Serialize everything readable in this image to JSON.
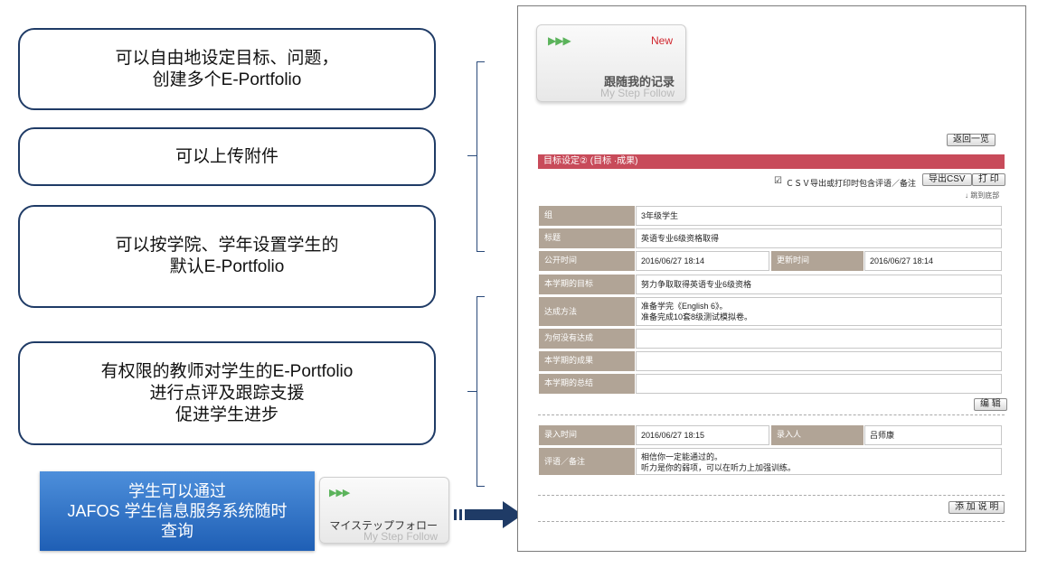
{
  "features": [
    {
      "lines": [
        "可以自由地设定目标、问题，",
        "创建多个E-Portfolio"
      ]
    },
    {
      "lines": [
        "可以上传附件"
      ]
    },
    {
      "lines": [
        "可以按学院、学年设置学生的",
        "默认E-Portfolio"
      ]
    },
    {
      "lines": [
        "有权限的教师对学生的E-Portfolio",
        "进行点评及跟踪支援",
        "促进学生进步"
      ]
    }
  ],
  "blue_box": {
    "lines": [
      "学生可以通过",
      "JAFOS 学生信息服务系统随时",
      "查询"
    ]
  },
  "small_tile": {
    "arrows": "▶▶▶",
    "ja": "マイステップフォロー",
    "en": "My Step Follow"
  },
  "top_tile": {
    "arrows": "▶▶▶",
    "new": "New",
    "cn": "跟随我的记录",
    "en": "My Step Follow"
  },
  "panel": {
    "back_button": "返回一览",
    "header": "目标设定② (目标 ·成果)",
    "csv_check": "☑",
    "csv_text": "ＣＳＶ导出或打印时包含评语／备注",
    "csv_button": "导出CSV",
    "print_button": "打 印",
    "jump_link": "↓ 跳到底部",
    "rows": [
      {
        "label": "组",
        "value": "3年级学生"
      },
      {
        "label": "标题",
        "value": "英语专业6级资格取得"
      },
      {
        "label": "公开时间",
        "value": "2016/06/27 18:14",
        "label2": "更新时间",
        "value2": "2016/06/27 18:14"
      },
      {
        "label": "本学期的目标",
        "value": "努力争取取得英语专业6级资格"
      },
      {
        "label": "达成方法",
        "value": "准备学完《English 6》。",
        "value_line2": "准备完成10套8级测试模拟卷。"
      },
      {
        "label": "为何没有达成",
        "value": ""
      },
      {
        "label": "本学期的成果",
        "value": ""
      },
      {
        "label": "本学期的总结",
        "value": ""
      }
    ],
    "edit_button": "编 辑",
    "comment": {
      "label": "录入时间",
      "value": "2016/06/27 18:15",
      "label2": "录入人",
      "value2": "吕师康",
      "note_label": "评语／备注",
      "note_line1": "相信你一定能通过的。",
      "note_line2": "听力是你的弱项，可以在听力上加强训练。"
    },
    "add_button": "添 加 说 明"
  },
  "colors": {
    "header_red": "#c84b5a",
    "label_tan": "#b1a496",
    "border_navy": "#1f3b66",
    "blue": "#1f5fb5"
  }
}
